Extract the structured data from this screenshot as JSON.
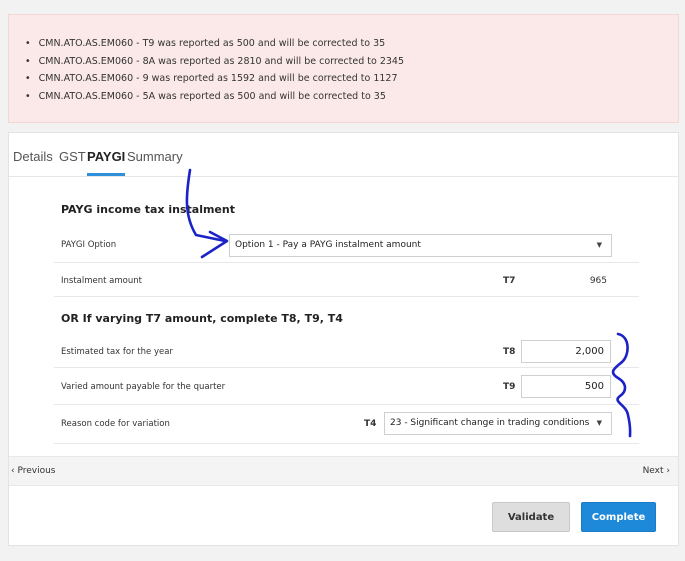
{
  "alerts": [
    "CMN.ATO.AS.EM060 - T9 was reported as 500 and will be corrected to 35",
    "CMN.ATO.AS.EM060 - 8A was reported as 2810 and will be corrected to 2345",
    "CMN.ATO.AS.EM060 - 9 was reported as 1592 and will be corrected to 1127",
    "CMN.ATO.AS.EM060 - 5A was reported as 500 and will be corrected to 35"
  ],
  "tabs": [
    "Details",
    "GST",
    "PAYGI",
    "Summary"
  ],
  "active_tab": "PAYGI",
  "section1_title": "PAYG income tax instalment",
  "paygi_option": {
    "label": "PAYGI Option",
    "selected": "Option 1 - Pay a PAYG instalment amount"
  },
  "instalment": {
    "label": "Instalment amount",
    "code": "T7",
    "value": "965"
  },
  "section2_title": "OR If varying T7 amount, complete T8, T9, T4",
  "estimated_tax": {
    "label": "Estimated tax for the year",
    "code": "T8",
    "value": "2,000"
  },
  "varied_amount": {
    "label": "Varied amount payable for the quarter",
    "code": "T9",
    "value": "500"
  },
  "reason_code": {
    "label": "Reason code for variation",
    "code": "T4",
    "selected": "23 - Significant change in trading conditions"
  },
  "nav": {
    "previous": "‹ Previous",
    "next": "Next ›"
  },
  "buttons": {
    "validate": "Validate",
    "complete": "Complete"
  },
  "icons": {
    "dropdown": "chevron-down-icon"
  },
  "colors": {
    "accent": "#1e88d9",
    "alert_bg": "#fbe9e9",
    "annotation": "#1a22c8"
  }
}
